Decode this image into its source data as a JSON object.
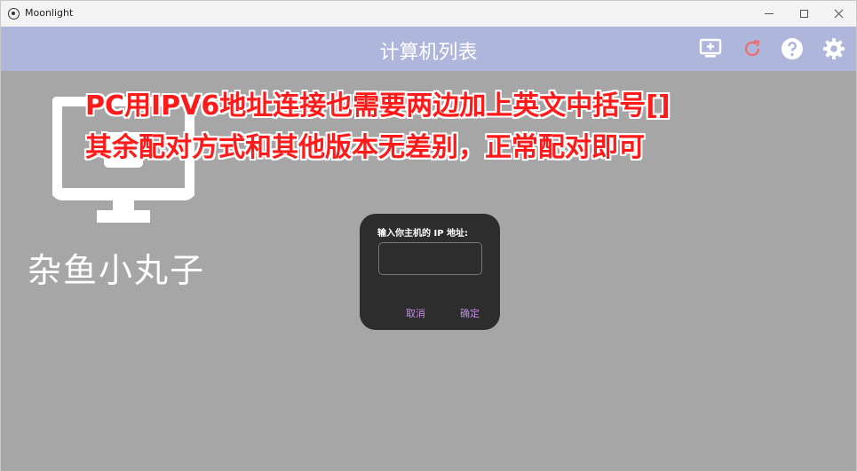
{
  "window": {
    "app_title": "Moonlight",
    "icons": {
      "app": "moonlight-logo-icon",
      "minimize": "minimize-icon",
      "maximize": "maximize-icon",
      "close": "close-icon"
    }
  },
  "toolbar": {
    "title": "计算机列表",
    "background": "#afb6dc",
    "icons": {
      "add_pc": "add-pc-icon",
      "refresh": "refresh-icon",
      "help": "help-icon",
      "settings": "settings-gear-icon"
    },
    "refresh_color": "#f06b6b"
  },
  "computers": [
    {
      "name": "杂鱼小丸子",
      "icon": "desktop-pc-icon"
    }
  ],
  "overlay_annotation": {
    "line1": "PC用IPV6地址连接也需要两边加上英文中括号[]",
    "line2": "其余配对方式和其他版本无差别，正常配对即可",
    "color": "#ff1a1a"
  },
  "dialog": {
    "label": "输入你主机的 IP 地址:",
    "input_value": "",
    "cancel_label": "取消",
    "ok_label": "确定",
    "accent": "#c18be6"
  }
}
